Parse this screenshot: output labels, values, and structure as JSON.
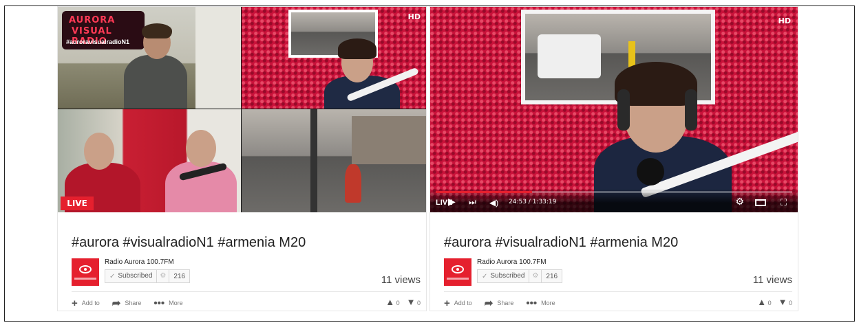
{
  "cards": [
    {
      "live_badge": "LIVE",
      "hd_label": "HD",
      "overlay": {
        "line1": "AURORA",
        "line2": "VISUAL RADIO",
        "line3": "#auroravisualradioN1"
      },
      "title": "#aurora #visualradioN1 #armenia M20",
      "channel_name": "Radio Aurora 100.7FM",
      "subscribe_label": "Subscribed",
      "subscriber_count": "216",
      "views": "11 views",
      "actions": {
        "add": "Add to",
        "share": "Share",
        "more": "More"
      },
      "likes": "0",
      "dislikes": "0"
    },
    {
      "hd_label": "HD",
      "live_label": "LIVE",
      "time": "24:53 / 1:33:19",
      "progress": 0.27,
      "title": "#aurora #visualradioN1 #armenia M20",
      "channel_name": "Radio Aurora 100.7FM",
      "subscribe_label": "Subscribed",
      "subscriber_count": "216",
      "views": "11 views",
      "actions": {
        "add": "Add to",
        "share": "Share",
        "more": "More"
      },
      "likes": "0",
      "dislikes": "0"
    }
  ],
  "icons": [
    "add-icon",
    "share-icon",
    "more-icon",
    "thumbs-up-icon",
    "thumbs-down-icon",
    "play-icon",
    "next-icon",
    "volume-icon",
    "settings-icon",
    "theater-icon",
    "fullscreen-icon",
    "check-icon",
    "bell-icon"
  ],
  "colors": {
    "accent": "#e5202e",
    "wall": "#c9123a"
  }
}
